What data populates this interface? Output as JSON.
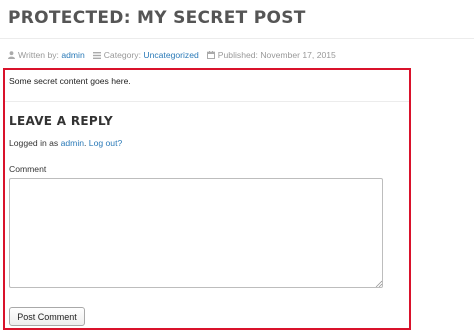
{
  "post": {
    "title": "PROTECTED: MY SECRET POST",
    "meta": {
      "written_by_label": "Written by:",
      "author": "admin",
      "category_label": "Category:",
      "category": "Uncategorized",
      "published_label": "Published:",
      "published_date": "November 17, 2015",
      "icons": [
        "user-icon",
        "category-list-icon",
        "calendar-icon"
      ]
    },
    "content": "Some secret content goes here."
  },
  "reply": {
    "title": "LEAVE A REPLY",
    "logged_in_prefix": "Logged in as",
    "logged_in_user": "admin",
    "separator": ".",
    "logout_label": "Log out?",
    "comment_label": "Comment",
    "comment_value": "",
    "submit_label": "Post Comment"
  },
  "colors": {
    "link": "#2a7ab8",
    "highlight_border": "#d9122b",
    "title": "#555555",
    "meta_text": "#999999"
  }
}
